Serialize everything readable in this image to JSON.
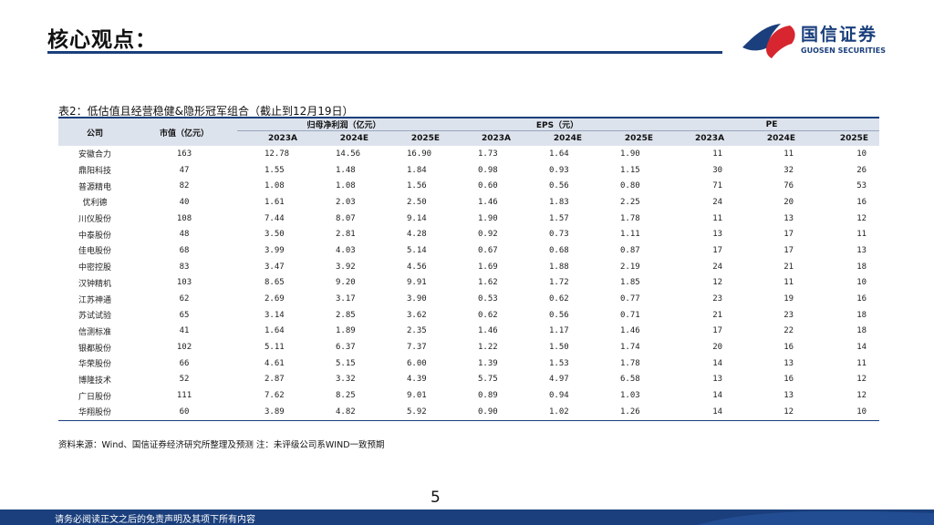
{
  "header": {
    "title": "核心观点：",
    "logo_cn": "国信证券",
    "logo_en": "GUOSEN SECURITIES"
  },
  "table": {
    "caption": "表2：低估值且经营稳健&隐形冠军组合（截止到12月19日）",
    "col_company": "公司",
    "col_mktcap": "市值（亿元）",
    "group_profit": "归母净利润（亿元）",
    "group_eps": "EPS（元）",
    "group_pe": "PE",
    "years": [
      "2023A",
      "2024E",
      "2025E",
      "2023A",
      "2024E",
      "2025E",
      "2023A",
      "2024E",
      "2025E"
    ],
    "rows": [
      [
        "安徽合力",
        "163",
        "12.78",
        "14.56",
        "16.90",
        "1.73",
        "1.64",
        "1.90",
        "11",
        "11",
        "10"
      ],
      [
        "鼎阳科技",
        "47",
        "1.55",
        "1.48",
        "1.84",
        "0.98",
        "0.93",
        "1.15",
        "30",
        "32",
        "26"
      ],
      [
        "普源精电",
        "82",
        "1.08",
        "1.08",
        "1.56",
        "0.60",
        "0.56",
        "0.80",
        "71",
        "76",
        "53"
      ],
      [
        "优利德",
        "40",
        "1.61",
        "2.03",
        "2.50",
        "1.46",
        "1.83",
        "2.25",
        "24",
        "20",
        "16"
      ],
      [
        "川仪股份",
        "108",
        "7.44",
        "8.07",
        "9.14",
        "1.90",
        "1.57",
        "1.78",
        "11",
        "13",
        "12"
      ],
      [
        "中泰股份",
        "48",
        "3.50",
        "2.81",
        "4.28",
        "0.92",
        "0.73",
        "1.11",
        "13",
        "17",
        "11"
      ],
      [
        "佳电股份",
        "68",
        "3.99",
        "4.03",
        "5.14",
        "0.67",
        "0.68",
        "0.87",
        "17",
        "17",
        "13"
      ],
      [
        "中密控股",
        "83",
        "3.47",
        "3.92",
        "4.56",
        "1.69",
        "1.88",
        "2.19",
        "24",
        "21",
        "18"
      ],
      [
        "汉钟精机",
        "103",
        "8.65",
        "9.20",
        "9.91",
        "1.62",
        "1.72",
        "1.85",
        "12",
        "11",
        "10"
      ],
      [
        "江苏神通",
        "62",
        "2.69",
        "3.17",
        "3.90",
        "0.53",
        "0.62",
        "0.77",
        "23",
        "19",
        "16"
      ],
      [
        "苏试试验",
        "65",
        "3.14",
        "2.85",
        "3.62",
        "0.62",
        "0.56",
        "0.71",
        "21",
        "23",
        "18"
      ],
      [
        "信测标准",
        "41",
        "1.64",
        "1.89",
        "2.35",
        "1.46",
        "1.17",
        "1.46",
        "17",
        "22",
        "18"
      ],
      [
        "银都股份",
        "102",
        "5.11",
        "6.37",
        "7.37",
        "1.22",
        "1.50",
        "1.74",
        "20",
        "16",
        "14"
      ],
      [
        "华荣股份",
        "66",
        "4.61",
        "5.15",
        "6.00",
        "1.39",
        "1.53",
        "1.78",
        "14",
        "13",
        "11"
      ],
      [
        "博隆技术",
        "52",
        "2.87",
        "3.32",
        "4.39",
        "5.75",
        "4.97",
        "6.58",
        "13",
        "16",
        "12"
      ],
      [
        "广日股份",
        "111",
        "7.62",
        "8.25",
        "9.01",
        "0.89",
        "0.94",
        "1.03",
        "14",
        "13",
        "12"
      ],
      [
        "华翔股份",
        "60",
        "3.89",
        "4.82",
        "5.92",
        "0.90",
        "1.02",
        "1.26",
        "14",
        "12",
        "10"
      ]
    ]
  },
  "source_note": "资料来源：Wind、国信证券经济研究所整理及预测 注：未评级公司系WIND一致预期",
  "page_number": "5",
  "footer": {
    "disclaimer": "请务必阅读正文之后的免责声明及其项下所有内容"
  },
  "colors": {
    "brand_blue": "#1a3f7c",
    "brand_red": "#d7262f",
    "header_fill": "#dde3ed"
  }
}
